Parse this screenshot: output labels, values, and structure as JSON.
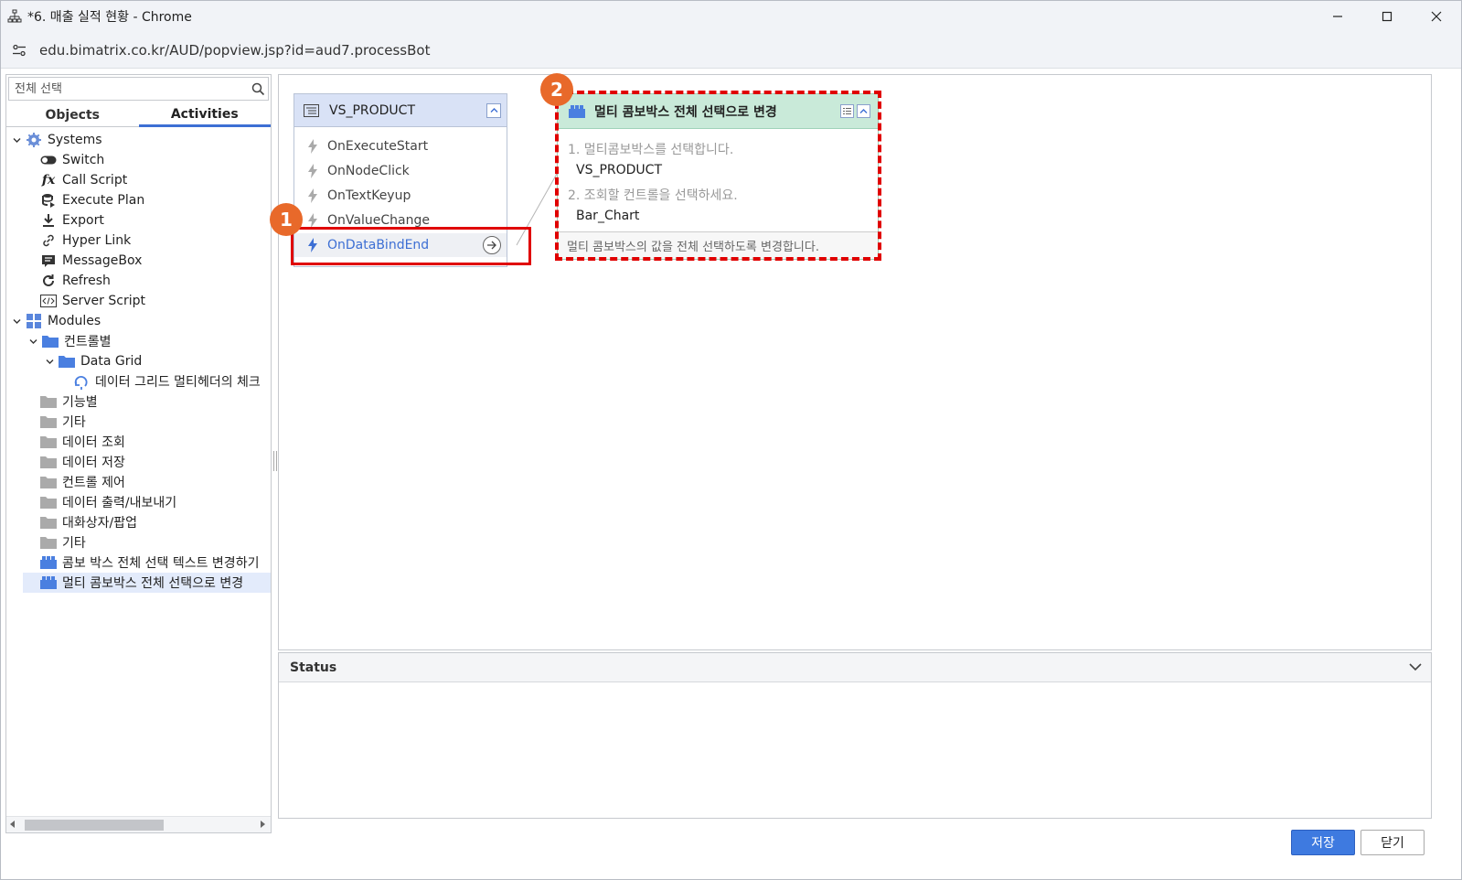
{
  "window": {
    "title": "*6. 매출 실적 현황 - Chrome",
    "url": "edu.bimatrix.co.kr/AUD/popview.jsp?id=aud7.processBot"
  },
  "left_panel": {
    "search_placeholder": "전체 선택",
    "tabs": [
      {
        "label": "Objects",
        "active": false
      },
      {
        "label": "Activities",
        "active": true
      }
    ],
    "tree": {
      "systems": {
        "label": "Systems",
        "items": [
          "Switch",
          "Call Script",
          "Execute Plan",
          "Export",
          "Hyper Link",
          "MessageBox",
          "Refresh",
          "Server Script"
        ]
      },
      "modules": {
        "label": "Modules"
      },
      "control_group": {
        "label": "컨트롤별"
      },
      "data_grid": {
        "label": "Data Grid"
      },
      "data_grid_item": {
        "label": "데이터 그리드 멀티헤더의 체크"
      },
      "folders": [
        "기능별",
        "기타",
        "데이터 조회",
        "데이터 저장",
        "컨트롤 제어",
        "데이터 출력/내보내기",
        "대화상자/팝업",
        "기타"
      ],
      "modules_items": [
        "콤보 박스 전체 선택 텍스트 변경하기",
        "멀티 콤보박스 전체 선택으로 변경"
      ]
    }
  },
  "canvas": {
    "object_node": {
      "name": "VS_PRODUCT",
      "events": [
        "OnExecuteStart",
        "OnNodeClick",
        "OnTextKeyup",
        "OnValueChange",
        "OnDataBindEnd"
      ]
    },
    "action_node": {
      "title": "멀티 콤보박스 전체 선택으로 변경",
      "param1_label": "1. 멀티콤보박스를 선택합니다.",
      "param1_value": "VS_PRODUCT",
      "param2_label": "2. 조회할 컨트롤을 선택하세요.",
      "param2_value": "Bar_Chart",
      "description": "멀티 콤보박스의 값을 전체 선택하도록 변경합니다."
    },
    "badges": [
      "1",
      "2"
    ]
  },
  "status": {
    "title": "Status"
  },
  "buttons": {
    "save": "저장",
    "close": "닫기"
  },
  "colors": {
    "accent": "#3d6fd4",
    "highlight": "#e00000",
    "badge": "#e8692a",
    "action_head": "#c9ead9",
    "object_head": "#d9e2f6"
  }
}
